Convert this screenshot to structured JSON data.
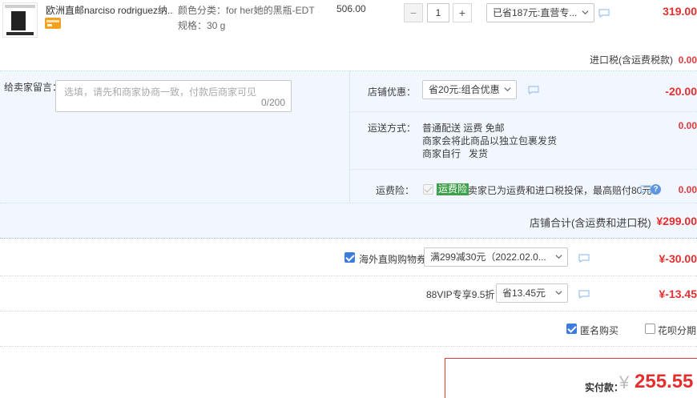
{
  "product": {
    "title": "欧洲直邮narciso rodriguez纳...",
    "sku_color": "颜色分类：for her她的黑瓶-EDT",
    "sku_spec": "规格：30 g",
    "unit_price": "506.00",
    "quantity": "1",
    "discount_select": "已省187元:直营专...",
    "total": "319.00"
  },
  "tax": {
    "label": "进口税(含运费税款)",
    "value": "0.00"
  },
  "memo": {
    "label": "给卖家留言：",
    "placeholder": "选填，请先和商家协商一致，付款后商家可见",
    "count": "0/200"
  },
  "shop_discount": {
    "label": "店铺优惠：",
    "select": "省20元:组合优惠",
    "value": "-20.00"
  },
  "shipping": {
    "label": "运送方式：",
    "line1": "普通配送 运费 免邮",
    "line2": "商家会将此商品以独立包裹发货",
    "line3": "商家自行   发货",
    "value": "0.00"
  },
  "insurance": {
    "label": "运费险：",
    "tag": "运费险",
    "text": "卖家已为运费和进口税投保，最高赔付80元",
    "value": "0.00"
  },
  "shop_total": {
    "label": "店铺合计(含运费和进口税)",
    "value": "¥299.00"
  },
  "coupon": {
    "label": "海外直购购物券",
    "select": "满299减30元（2022.02.0...",
    "value": "¥-30.00"
  },
  "vip": {
    "label": "88VIP专享9.5折",
    "select": "省13.45元",
    "value": "¥-13.45"
  },
  "options": {
    "anonymous": "匿名购买",
    "installment": "花呗分期"
  },
  "payment": {
    "label": "实付款：",
    "currency": "¥",
    "amount": "255.55"
  },
  "colors": {
    "accent_red": "#e4393c",
    "panel_blue": "#f2f7ff",
    "checkbox_blue": "#3d7cde",
    "tag_green": "#3fa14b"
  }
}
